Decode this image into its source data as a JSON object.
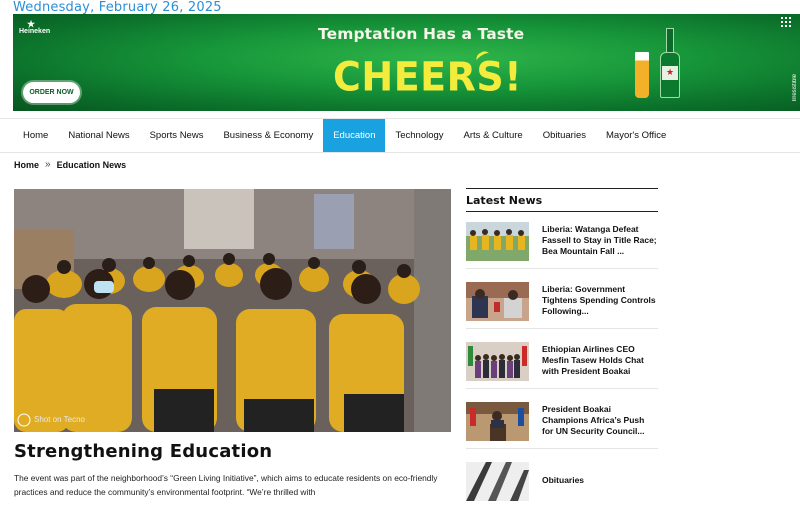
{
  "header": {
    "date": "Wednesday, February 26, 2025"
  },
  "banner": {
    "brand": "Heineken",
    "tagline": "Temptation Has a Taste",
    "headline": "CHEERS!",
    "cta": "ORDER NOW",
    "side_text": "Irresistible"
  },
  "nav": {
    "items": [
      {
        "label": "Home"
      },
      {
        "label": "National News"
      },
      {
        "label": "Sports News"
      },
      {
        "label": "Business & Economy"
      },
      {
        "label": "Education",
        "active": true
      },
      {
        "label": "Technology"
      },
      {
        "label": "Arts & Culture"
      },
      {
        "label": "Obituaries"
      },
      {
        "label": "Mayor's Office"
      }
    ]
  },
  "breadcrumb": {
    "home": "Home",
    "current": "Education News"
  },
  "article": {
    "image_watermark": "Shot on Tecno",
    "title": "Strengthening Education",
    "excerpt": "The event was part of the neighborhood’s “Green Living Initiative”, which aims to educate residents on eco-friendly practices and reduce the community’s environmental footprint. “We’re thrilled with"
  },
  "sidebar": {
    "heading": "Latest News",
    "items": [
      {
        "title": "Liberia: Watanga Defeat Fassell to Stay in Title Race; Bea Mountain Fall ...",
        "thumb": "football-players"
      },
      {
        "title": "Liberia: Government Tightens Spending Controls Following...",
        "thumb": "government-officials"
      },
      {
        "title": "Ethiopian Airlines CEO Mesfin Tasew Holds Chat with President Boakai",
        "thumb": "group-photo-flags"
      },
      {
        "title": "President Boakai Champions Africa’s Push for UN Security Council...",
        "thumb": "speaker-podium"
      },
      {
        "title": "Obituaries",
        "thumb": "architecture"
      }
    ]
  },
  "colors": {
    "accent": "#1aa1e0",
    "date": "#2a8fd6",
    "banner_green": "#17963a",
    "banner_yellow": "#f3ec3c"
  }
}
